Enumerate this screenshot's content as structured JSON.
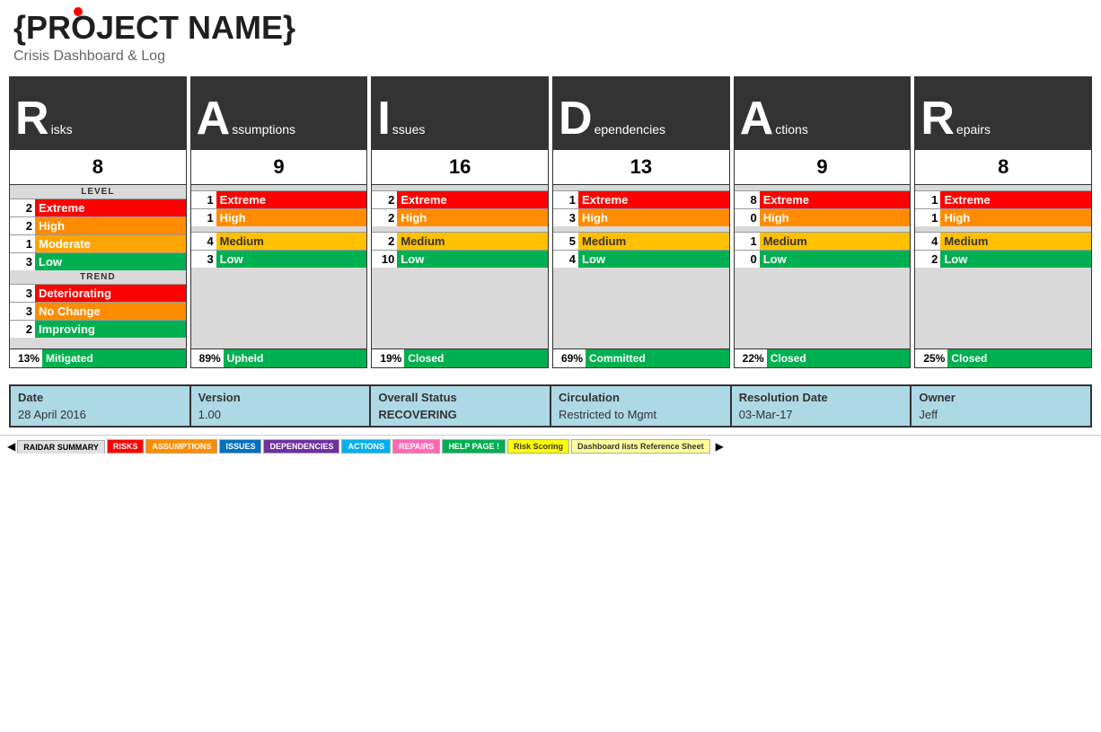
{
  "header": {
    "title": "{PROJECT NAME}",
    "subtitle": "Crisis Dashboard & Log"
  },
  "columns": [
    {
      "id": "risks",
      "letter": "R",
      "word": "isks",
      "count": 8,
      "hasLevelSection": true,
      "hasTrendSection": true,
      "levels": [
        {
          "label": "Extreme",
          "count": 2,
          "color": "extreme"
        },
        {
          "label": "High",
          "count": 2,
          "color": "high"
        },
        {
          "label": "Moderate",
          "count": 1,
          "color": "moderate"
        },
        {
          "label": "Low",
          "count": 3,
          "color": "low"
        }
      ],
      "trends": [
        {
          "label": "Deteriorating",
          "count": 3,
          "color": "deteriorating"
        },
        {
          "label": "No Change",
          "count": 3,
          "color": "nochange"
        },
        {
          "label": "Improving",
          "count": 2,
          "color": "improving"
        }
      ],
      "pct": "13%",
      "pctLabel": "Mitigated"
    },
    {
      "id": "assumptions",
      "letter": "A",
      "word": "ssumptions",
      "count": 9,
      "hasLevelSection": false,
      "hasTrendSection": false,
      "levels": [
        {
          "label": "Extreme",
          "count": 1,
          "color": "extreme"
        },
        {
          "label": "High",
          "count": 1,
          "color": "high"
        },
        {
          "label": "Medium",
          "count": 4,
          "color": "medium"
        },
        {
          "label": "Low",
          "count": 3,
          "color": "low"
        }
      ],
      "trends": [],
      "pct": "89%",
      "pctLabel": "Upheld"
    },
    {
      "id": "issues",
      "letter": "I",
      "word": "ssues",
      "count": 16,
      "hasLevelSection": false,
      "hasTrendSection": false,
      "levels": [
        {
          "label": "Extreme",
          "count": 2,
          "color": "extreme"
        },
        {
          "label": "High",
          "count": 2,
          "color": "high"
        },
        {
          "label": "Medium",
          "count": 2,
          "color": "medium"
        },
        {
          "label": "Low",
          "count": 10,
          "color": "low"
        }
      ],
      "trends": [],
      "pct": "19%",
      "pctLabel": "Closed"
    },
    {
      "id": "dependencies",
      "letter": "D",
      "word": "ependencies",
      "count": 13,
      "hasLevelSection": false,
      "hasTrendSection": false,
      "levels": [
        {
          "label": "Extreme",
          "count": 1,
          "color": "extreme"
        },
        {
          "label": "High",
          "count": 3,
          "color": "high"
        },
        {
          "label": "Medium",
          "count": 5,
          "color": "medium"
        },
        {
          "label": "Low",
          "count": 4,
          "color": "low"
        }
      ],
      "trends": [],
      "pct": "69%",
      "pctLabel": "Committed"
    },
    {
      "id": "actions",
      "letter": "A",
      "word": "ctions",
      "count": 9,
      "hasLevelSection": false,
      "hasTrendSection": false,
      "levels": [
        {
          "label": "Extreme",
          "count": 8,
          "color": "extreme"
        },
        {
          "label": "High",
          "count": 0,
          "color": "high"
        },
        {
          "label": "Medium",
          "count": 1,
          "color": "medium"
        },
        {
          "label": "Low",
          "count": 0,
          "color": "low"
        }
      ],
      "trends": [],
      "pct": "22%",
      "pctLabel": "Closed"
    },
    {
      "id": "repairs",
      "letter": "R",
      "word": "epairs",
      "count": 8,
      "hasLevelSection": false,
      "hasTrendSection": false,
      "levels": [
        {
          "label": "Extreme",
          "count": 1,
          "color": "extreme"
        },
        {
          "label": "High",
          "count": 1,
          "color": "high"
        },
        {
          "label": "Medium",
          "count": 4,
          "color": "medium"
        },
        {
          "label": "Low",
          "count": 2,
          "color": "low"
        }
      ],
      "trends": [],
      "pct": "25%",
      "pctLabel": "Closed"
    }
  ],
  "infoBar": {
    "date_label": "Date",
    "date_value": "28 April 2016",
    "version_label": "Version",
    "version_value": "1.00",
    "status_label": "Overall Status",
    "status_value": "RECOVERING",
    "circulation_label": "Circulation",
    "circulation_value": "Restricted to Mgmt",
    "resolution_label": "Resolution Date",
    "resolution_value": "03-Mar-17",
    "owner_label": "Owner",
    "owner_value": "Jeff"
  },
  "tabs": [
    {
      "label": "RAIDAR SUMMARY",
      "style": "active"
    },
    {
      "label": "RISKS",
      "style": "red"
    },
    {
      "label": "ASSUMPTIONS",
      "style": "orange"
    },
    {
      "label": "ISSUES",
      "style": "blue"
    },
    {
      "label": "DEPENDENCIES",
      "style": "purple"
    },
    {
      "label": "ACTIONS",
      "style": "teal"
    },
    {
      "label": "REPAIRS",
      "style": "pink"
    },
    {
      "label": "HELP PAGE !",
      "style": "green"
    },
    {
      "label": "Risk Scoring",
      "style": "yellow"
    },
    {
      "label": "Dashboard lists Reference Sheet",
      "style": "lightyellow"
    }
  ]
}
